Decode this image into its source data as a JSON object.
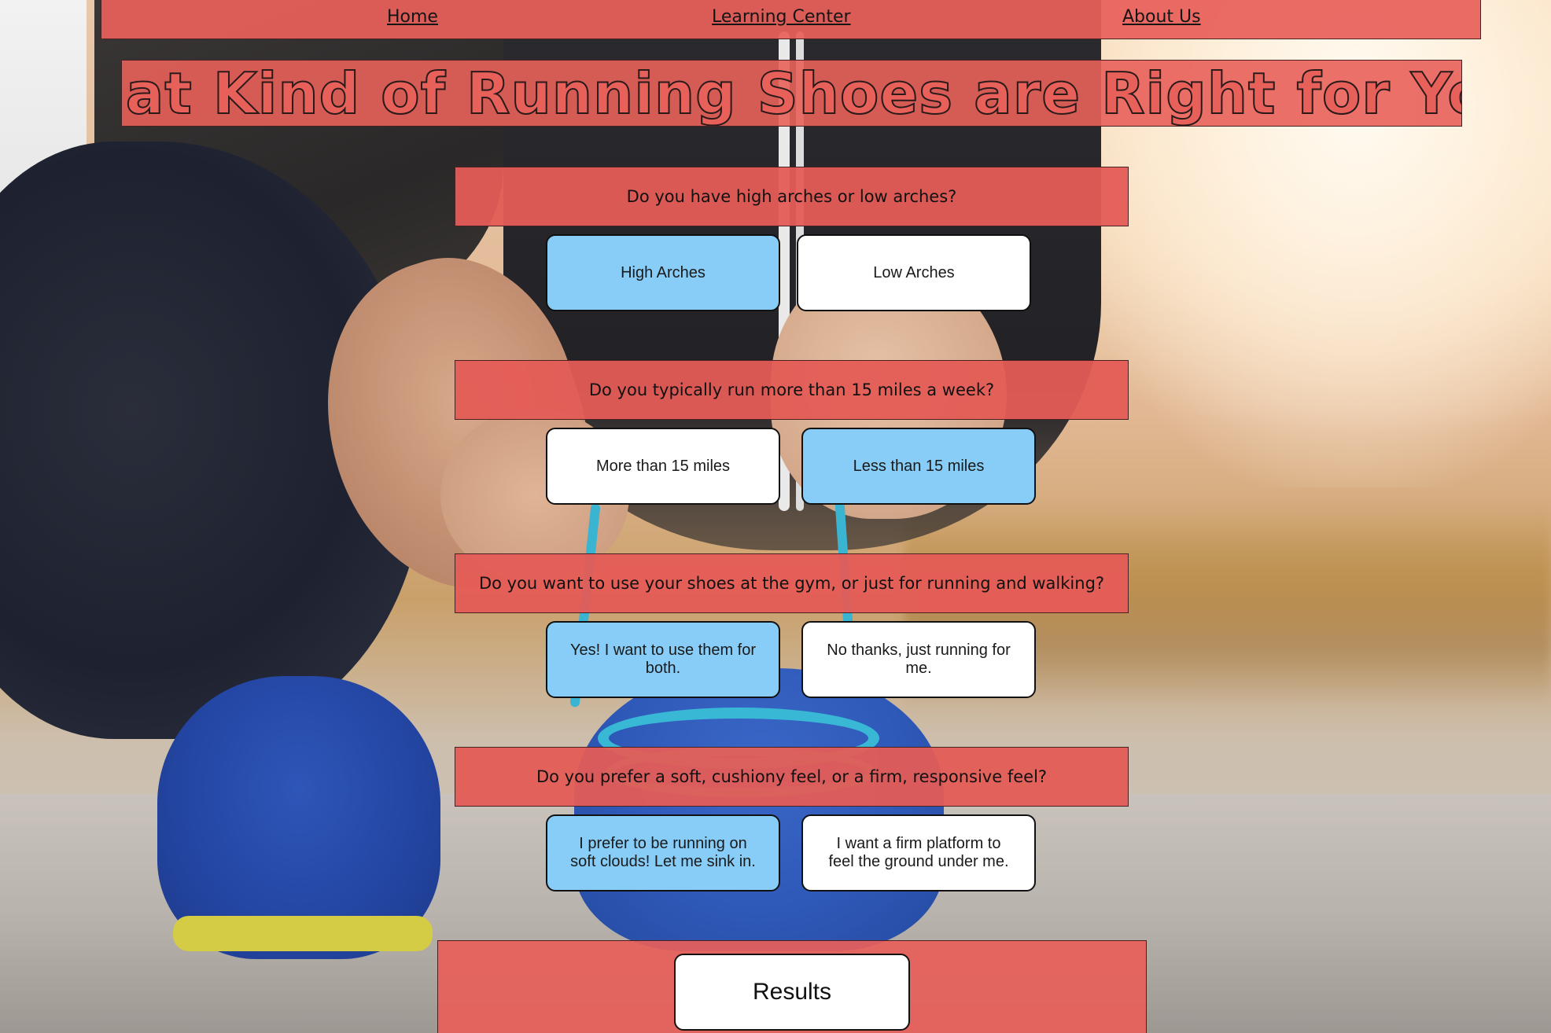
{
  "nav": {
    "home": "Home",
    "learning_center": "Learning Center",
    "about_us": "About Us"
  },
  "title": "What Kind of Running Shoes are Right for You?",
  "questions": [
    {
      "text": "Do you have high arches or low arches?",
      "options": [
        {
          "label": "High Arches",
          "selected": true
        },
        {
          "label": "Low Arches",
          "selected": false
        }
      ]
    },
    {
      "text": "Do you typically run more than 15 miles a week?",
      "options": [
        {
          "label": "More than 15 miles",
          "selected": false
        },
        {
          "label": "Less than 15 miles",
          "selected": true
        }
      ]
    },
    {
      "text": "Do you want to use your shoes at the gym, or just for running and walking?",
      "options": [
        {
          "label": "Yes! I want to use them for both.",
          "selected": true
        },
        {
          "label": "No thanks, just running for me.",
          "selected": false
        }
      ]
    },
    {
      "text": "Do you prefer a soft, cushiony feel, or a firm, responsive feel?",
      "options": [
        {
          "label": "I prefer to be running on soft clouds! Let me sink in.",
          "selected": true
        },
        {
          "label": "I want a firm platform to feel the ground under me.",
          "selected": false
        }
      ]
    }
  ],
  "results_label": "Results",
  "colors": {
    "panel": "#e8605a",
    "selected": "#87cdf7",
    "unselected": "#ffffff"
  }
}
